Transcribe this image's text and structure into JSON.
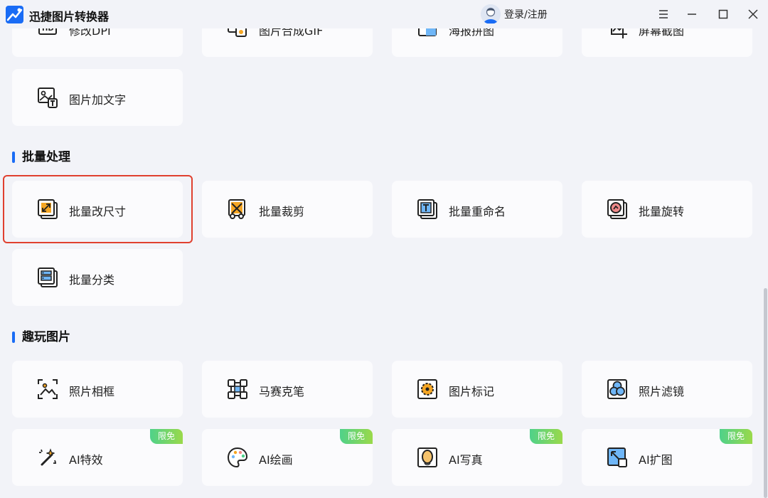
{
  "app": {
    "title": "迅捷图片转换器",
    "login_label": "登录/注册",
    "accent": "#1a6cf5"
  },
  "window_controls": [
    "menu-icon",
    "minimize-icon",
    "maximize-icon",
    "close-icon"
  ],
  "top_row": [
    {
      "label": "修改DPI",
      "icon": "hd-icon"
    },
    {
      "label": "图片合成GIF",
      "icon": "gif-icon"
    },
    {
      "label": "海报拼图",
      "icon": "poster-icon"
    },
    {
      "label": "屏幕截图",
      "icon": "screenshot-icon"
    }
  ],
  "image_edit": {
    "add_text_label": "图片加文字"
  },
  "batch": {
    "title": "批量处理",
    "items": [
      {
        "label": "批量改尺寸",
        "icon": "resize-icon"
      },
      {
        "label": "批量裁剪",
        "icon": "crop-icon"
      },
      {
        "label": "批量重命名",
        "icon": "rename-icon"
      },
      {
        "label": "批量旋转",
        "icon": "rotate-icon"
      },
      {
        "label": "批量分类",
        "icon": "classify-icon"
      }
    ]
  },
  "fun": {
    "title": "趣玩图片",
    "items": [
      {
        "label": "照片相框",
        "icon": "frame-icon"
      },
      {
        "label": "马赛克笔",
        "icon": "mosaic-icon"
      },
      {
        "label": "图片标记",
        "icon": "mark-icon"
      },
      {
        "label": "照片滤镜",
        "icon": "filter-icon"
      },
      {
        "label": "AI特效",
        "icon": "magic-wand-icon",
        "badge": "限免"
      },
      {
        "label": "AI绘画",
        "icon": "palette-icon",
        "badge": "限免"
      },
      {
        "label": "AI写真",
        "icon": "portrait-icon",
        "badge": "限免"
      },
      {
        "label": "AI扩图",
        "icon": "expand-icon",
        "badge": "限免"
      }
    ]
  }
}
